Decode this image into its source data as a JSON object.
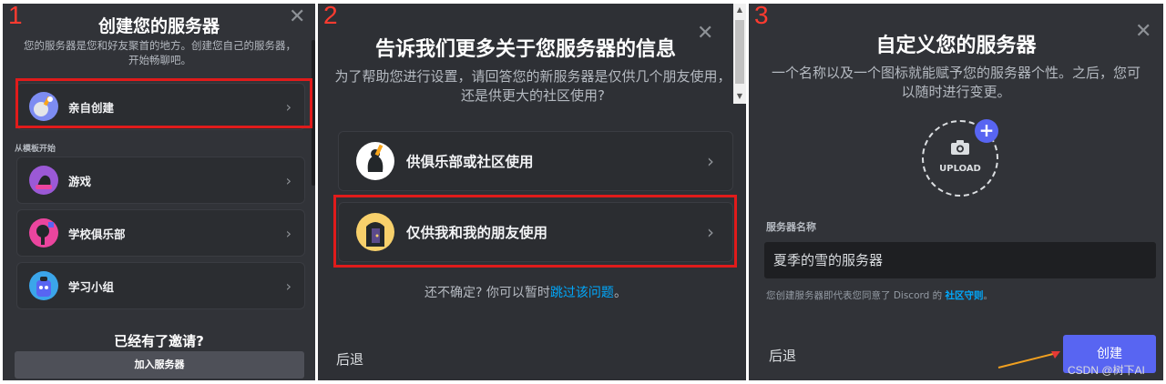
{
  "steps": [
    "1",
    "2",
    "3"
  ],
  "panel1": {
    "title": "创建您的服务器",
    "description": "您的服务器是您和好友聚首的地方。创建您自己的服务器，开始畅聊吧。",
    "create_own": "亲自创建",
    "template_section": "从模板开始",
    "templates": [
      {
        "label": "游戏",
        "icon": "gaming-icon"
      },
      {
        "label": "学校俱乐部",
        "icon": "school-club-icon"
      },
      {
        "label": "学习小组",
        "icon": "study-group-icon"
      }
    ],
    "invite_heading": "已经有了邀请?",
    "join_button": "加入服务器",
    "close": "✕",
    "chevron": "›"
  },
  "panel2": {
    "title": "告诉我们更多关于您服务器的信息",
    "description": "为了帮助您进行设置，请回答您的新服务器是仅供几个朋友使用，还是供更大的社区使用?",
    "options": [
      {
        "label": "供俱乐部或社区使用",
        "icon": "club-community-icon"
      },
      {
        "label": "仅供我和我的朋友使用",
        "icon": "friends-icon"
      }
    ],
    "unsure_text": "还不确定? 你可以暂时",
    "skip_link": "跳过该问题",
    "unsure_end": "。",
    "back": "后退",
    "close": "✕",
    "chevron": "›"
  },
  "panel3": {
    "title": "自定义您的服务器",
    "description": "一个名称以及一个图标就能赋予您的服务器个性。之后，您可以随时进行变更。",
    "upload_text": "UPLOAD",
    "plus": "+",
    "name_label": "服务器名称",
    "name_value": "夏季的雪的服务器",
    "terms_text": "您创建服务器即代表您同意了 Discord 的 ",
    "terms_link": "社区守则",
    "terms_end": "。",
    "back": "后退",
    "create_button": "创建",
    "close": "✕",
    "watermark": "CSDN @树下AI"
  },
  "colors": {
    "background": "#313338",
    "highlight_box": "#e01b1b",
    "blurple": "#5865f2",
    "link": "#00a8fc",
    "step_number": "#ff3b30"
  }
}
